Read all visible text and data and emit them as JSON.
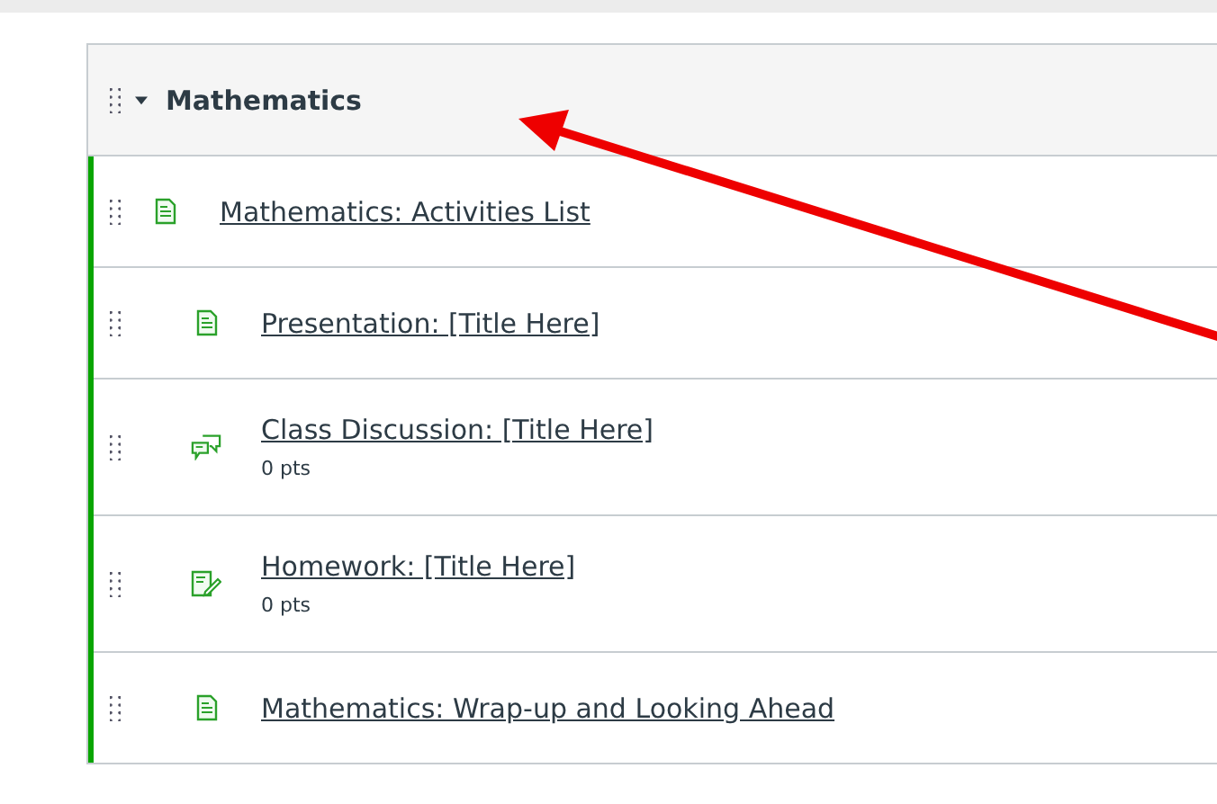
{
  "module": {
    "title": "Mathematics",
    "expanded": true,
    "items": [
      {
        "kind": "page",
        "title": "Mathematics: Activities List",
        "children": [
          {
            "kind": "page",
            "title": "Presentation: [Title Here]"
          },
          {
            "kind": "discussion",
            "title": "Class Discussion: [Title Here]",
            "points": "0 pts"
          },
          {
            "kind": "assignment",
            "title": "Homework: [Title Here]",
            "points": "0 pts"
          },
          {
            "kind": "page",
            "title": "Mathematics: Wrap-up and Looking Ahead"
          }
        ]
      }
    ]
  }
}
